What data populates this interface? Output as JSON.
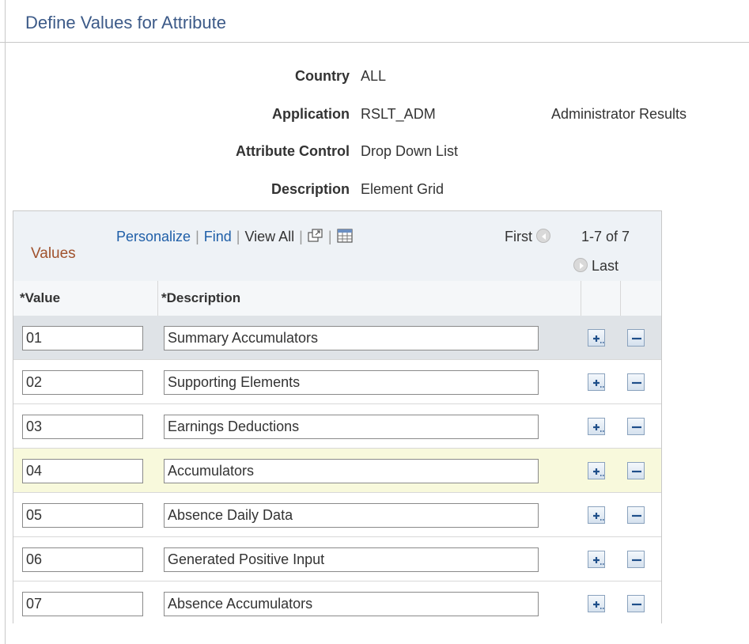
{
  "page": {
    "title": "Define Values for Attribute"
  },
  "fields": [
    {
      "label": "Country",
      "value": "ALL",
      "extra": ""
    },
    {
      "label": "Application",
      "value": "RSLT_ADM",
      "extra": "Administrator Results"
    },
    {
      "label": "Attribute Control",
      "value": "Drop Down List",
      "extra": ""
    },
    {
      "label": "Description",
      "value": "Element Grid",
      "extra": ""
    }
  ],
  "grid": {
    "title": "Values",
    "personalize": "Personalize",
    "find": "Find",
    "view_all": "View All",
    "first": "First",
    "count": "1-7 of 7",
    "last": "Last",
    "columns": {
      "value": "*Value",
      "description": "*Description"
    },
    "rows": [
      {
        "value": "01",
        "description": "Summary Accumulators"
      },
      {
        "value": "02",
        "description": "Supporting Elements"
      },
      {
        "value": "03",
        "description": "Earnings Deductions"
      },
      {
        "value": "04",
        "description": "Accumulators"
      },
      {
        "value": "05",
        "description": "Absence Daily Data"
      },
      {
        "value": "06",
        "description": "Generated Positive Input"
      },
      {
        "value": "07",
        "description": "Absence Accumulators"
      }
    ]
  },
  "icons": {
    "zoom": "new-window-icon",
    "download": "spreadsheet-icon",
    "prev": "previous-arrow-icon",
    "next": "next-arrow-icon",
    "add": "add-row-icon",
    "delete": "delete-row-icon"
  },
  "colors": {
    "title": "#3c5a88",
    "link": "#1f5fa8",
    "grid_title": "#a0522d",
    "hover_row": "#f8f9dc"
  }
}
